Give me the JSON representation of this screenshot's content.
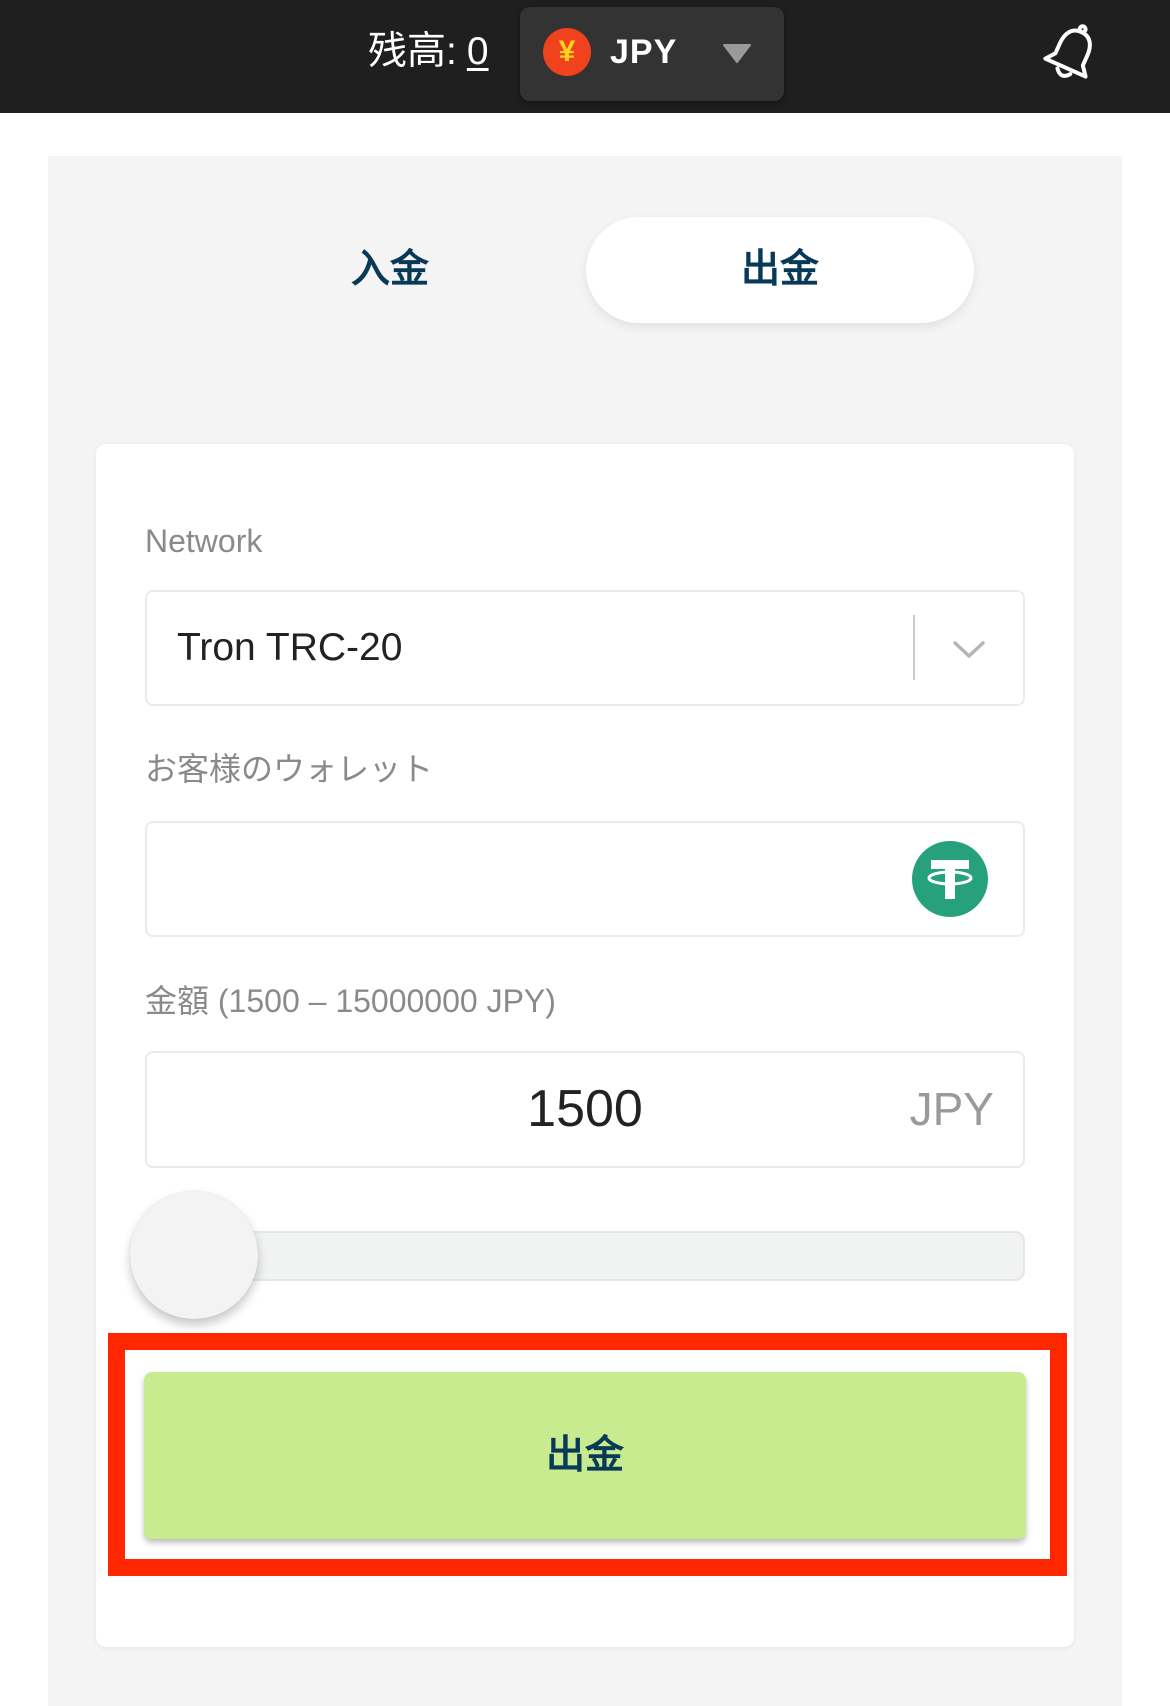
{
  "header": {
    "balance_label": "残高:",
    "balance_value": "0",
    "currency": {
      "symbol": "¥",
      "code": "JPY",
      "icon": "yen-icon",
      "caret_icon": "caret-down-icon"
    },
    "notification_icon": "bell-icon"
  },
  "tabs": [
    {
      "label": "入金",
      "active": false
    },
    {
      "label": "出金",
      "active": true
    }
  ],
  "form": {
    "network_label": "Network",
    "network_value": "Tron TRC-20",
    "network_icon": "chevron-down-icon",
    "wallet_label": "お客様のウォレット",
    "wallet_icon": "tether-icon",
    "amount_label": "金額 (1500 – 15000000 JPY)",
    "amount_value": "1500",
    "amount_unit": "JPY",
    "slider": {
      "min": 1500,
      "max": 15000000,
      "value": 1500
    },
    "submit_label": "出金"
  },
  "colors": {
    "accent": "#083a57",
    "button": "#c8eb8f",
    "highlight": "#ff2600",
    "tether": "#26a17b",
    "topbar": "#1f1f1f"
  }
}
